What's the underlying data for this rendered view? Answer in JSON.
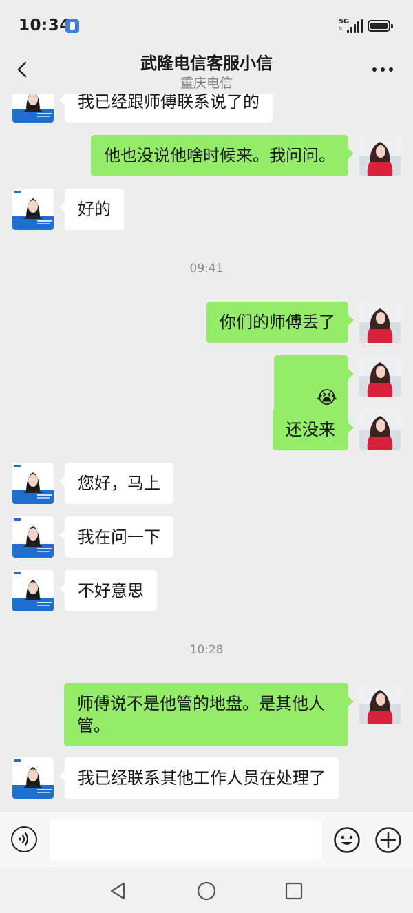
{
  "status_bar": {
    "time": "10:34",
    "network": "5G",
    "network_sub": "⇅",
    "battery_level": 0.9
  },
  "header": {
    "back_icon": "chevron-left-icon",
    "title": "武隆电信客服小信",
    "subtitle": "重庆电信",
    "more_icon": "more-horizontal-icon"
  },
  "colors": {
    "background": "#ededed",
    "bubble_self": "#95ec69",
    "bubble_other": "#ffffff",
    "timestamp": "#8a8a8a"
  },
  "messages": [
    {
      "side": "left",
      "text": "我已经跟师傅联系说了的"
    },
    {
      "side": "right",
      "text": "他也没说他啥时候来。我问问。"
    },
    {
      "side": "left",
      "text": "好的"
    },
    {
      "type": "time",
      "text": "09:41"
    },
    {
      "side": "right",
      "text": "你们的师傅丢了"
    },
    {
      "side": "right",
      "text": "😭"
    },
    {
      "side": "right",
      "text": "还没来"
    },
    {
      "side": "left",
      "text": "您好，马上"
    },
    {
      "side": "left",
      "text": "我在问一下"
    },
    {
      "side": "left",
      "text": "不好意思"
    },
    {
      "type": "time",
      "text": "10:28"
    },
    {
      "side": "right",
      "text": "师傅说不是他管的地盘。是其他人管。"
    },
    {
      "side": "left",
      "text": "我已经联系其他工作人员在处理了"
    }
  ],
  "input_bar": {
    "voice_icon": "voice-icon",
    "input_value": "",
    "emoji_icon": "emoji-icon",
    "plus_icon": "plus-circle-icon"
  },
  "nav_bar": {
    "back_icon": "triangle-back-icon",
    "home_icon": "circle-home-icon",
    "recents_icon": "square-recents-icon"
  }
}
